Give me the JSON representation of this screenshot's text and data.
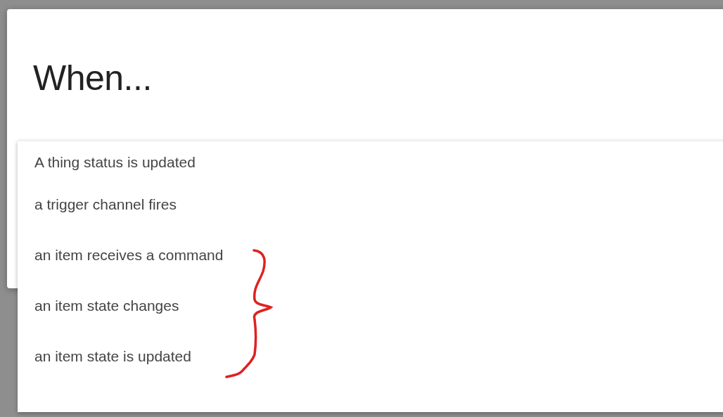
{
  "dialog": {
    "title": "When..."
  },
  "menu": {
    "items": [
      {
        "label": "A thing status is updated"
      },
      {
        "label": "a trigger channel fires"
      },
      {
        "label": "an item receives a command"
      },
      {
        "label": "an item state changes"
      },
      {
        "label": "an item state is updated"
      }
    ]
  }
}
